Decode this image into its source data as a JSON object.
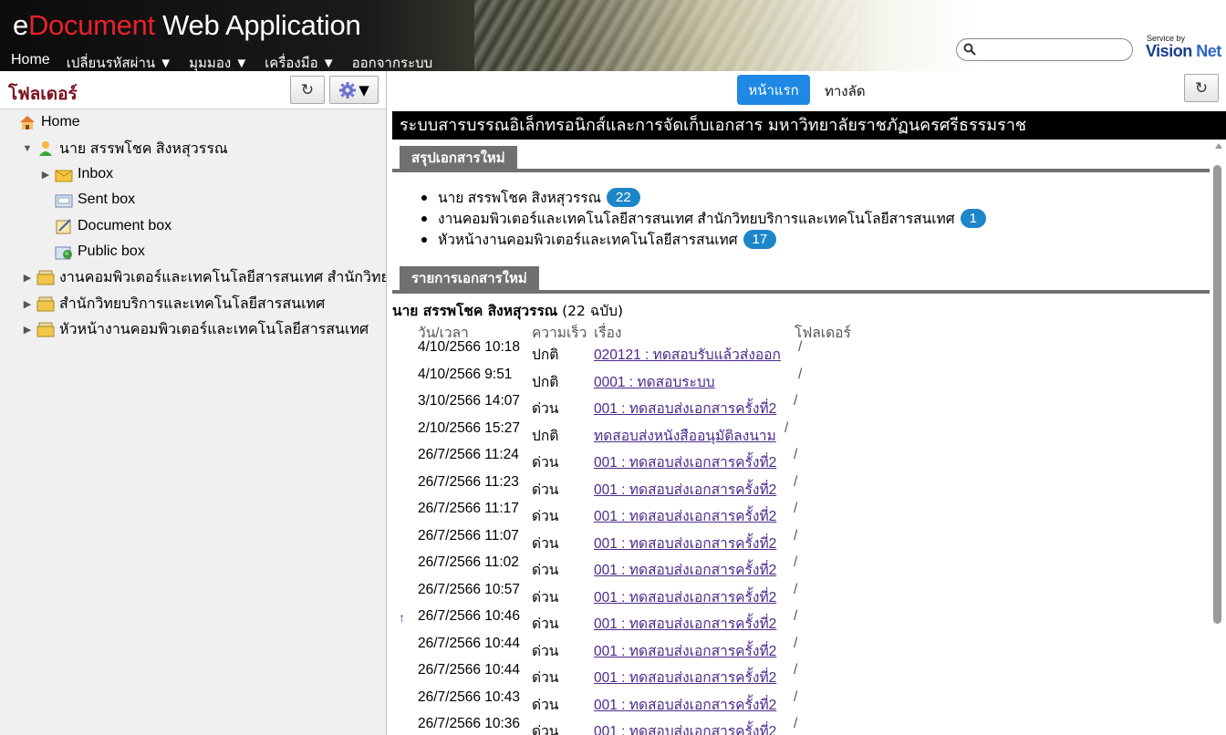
{
  "header": {
    "title_e": "e",
    "title_document": "Document",
    "title_rest": " Web Application",
    "nav": [
      {
        "label": "Home"
      },
      {
        "label": "เปลี่ยนรหัสผ่าน ▼"
      },
      {
        "label": "มุมมอง ▼"
      },
      {
        "label": "เครื่องมือ ▼"
      },
      {
        "label": "ออกจากระบบ"
      }
    ],
    "search": {
      "value": "",
      "placeholder": ""
    },
    "service_by": "Service by",
    "vision": "Vision",
    "net": "Net"
  },
  "left": {
    "title": "โฟลเดอร์",
    "refresh_icon": "refresh-icon",
    "settings_icon": "gear-icon",
    "tree": [
      {
        "label": "Home",
        "icon": "home-icon"
      },
      {
        "label": "นาย สรรพโชค สิงหสุวรรณ",
        "icon": "user-icon",
        "expanded": true
      },
      {
        "label": "Inbox",
        "icon": "inbox-icon"
      },
      {
        "label": "Sent box",
        "icon": "sent-box-icon"
      },
      {
        "label": "Document box",
        "icon": "document-box-icon"
      },
      {
        "label": "Public box",
        "icon": "public-box-icon"
      },
      {
        "label": "งานคอมพิวเตอร์และเทคโนโลยีสารสนเทศ สำนักวิทย",
        "icon": "folder-stack-icon"
      },
      {
        "label": "สำนักวิทยบริการและเทคโนโลยีสารสนเทศ",
        "icon": "folder-stack-icon"
      },
      {
        "label": "หัวหน้างานคอมพิวเตอร์และเทคโนโลยีสารสนเทศ",
        "icon": "folder-stack-icon"
      }
    ]
  },
  "right": {
    "tab_home": "หน้าแรก",
    "tab_shortcut": "ทางลัด",
    "banner": "ระบบสารบรรณอิเล็กทรอนิกส์และการจัดเก็บเอกสาร มหาวิทยาลัยราชภัฏนครศรีธรรมราช",
    "summary_title": "สรุปเอกสารใหม่",
    "summary": [
      {
        "label": "นาย สรรพโชค สิงหสุวรรณ",
        "count": "22"
      },
      {
        "label": "งานคอมพิวเตอร์และเทคโนโลยีสารสนเทศ สำนักวิทยบริการและเทคโนโลยีสารสนเทศ",
        "count": "1"
      },
      {
        "label": "หัวหน้างานคอมพิวเตอร์และเทคโนโลยีสารสนเทศ",
        "count": "17"
      }
    ],
    "list_title": "รายการเอกสารใหม่",
    "owner_name": "นาย สรรพโชค สิงหสุวรรณ",
    "owner_count": " (22 ฉบับ)",
    "columns": {
      "date": "วัน/เวลา",
      "speed": "ความเร็ว",
      "subject": "เรื่อง",
      "folder": "โฟลเดอร์"
    },
    "rows": [
      {
        "mark": "",
        "date": "4/10/2566 10:18",
        "speed": "ปกติ",
        "subject": "020121 : ทดสอบรับแล้วส่งออก",
        "folder": "/"
      },
      {
        "mark": "",
        "date": "4/10/2566 9:51",
        "speed": "ปกติ",
        "subject": "0001 : ทดสอบระบบ",
        "folder": "/"
      },
      {
        "mark": "",
        "date": "3/10/2566 14:07",
        "speed": "ด่วน",
        "subject": "001 : ทดสอบส่งเอกสารครั้งที่2",
        "folder": "/"
      },
      {
        "mark": "",
        "date": "2/10/2566 15:27",
        "speed": "ปกติ",
        "subject": "ทดสอบส่งหนังสืออนุมัติลงนาม",
        "folder": "/"
      },
      {
        "mark": "",
        "date": "26/7/2566 11:24",
        "speed": "ด่วน",
        "subject": "001 : ทดสอบส่งเอกสารครั้งที่2",
        "folder": "/"
      },
      {
        "mark": "",
        "date": "26/7/2566 11:23",
        "speed": "ด่วน",
        "subject": "001 : ทดสอบส่งเอกสารครั้งที่2",
        "folder": "/"
      },
      {
        "mark": "",
        "date": "26/7/2566 11:17",
        "speed": "ด่วน",
        "subject": "001 : ทดสอบส่งเอกสารครั้งที่2",
        "folder": "/"
      },
      {
        "mark": "",
        "date": "26/7/2566 11:07",
        "speed": "ด่วน",
        "subject": "001 : ทดสอบส่งเอกสารครั้งที่2",
        "folder": "/"
      },
      {
        "mark": "",
        "date": "26/7/2566 11:02",
        "speed": "ด่วน",
        "subject": "001 : ทดสอบส่งเอกสารครั้งที่2",
        "folder": "/"
      },
      {
        "mark": "",
        "date": "26/7/2566 10:57",
        "speed": "ด่วน",
        "subject": "001 : ทดสอบส่งเอกสารครั้งที่2",
        "folder": "/"
      },
      {
        "mark": "↑",
        "date": "26/7/2566 10:46",
        "speed": "ด่วน",
        "subject": "001 : ทดสอบส่งเอกสารครั้งที่2",
        "folder": "/"
      },
      {
        "mark": "",
        "date": "26/7/2566 10:44",
        "speed": "ด่วน",
        "subject": "001 : ทดสอบส่งเอกสารครั้งที่2",
        "folder": "/"
      },
      {
        "mark": "",
        "date": "26/7/2566 10:44",
        "speed": "ด่วน",
        "subject": "001 : ทดสอบส่งเอกสารครั้งที่2",
        "folder": "/"
      },
      {
        "mark": "",
        "date": "26/7/2566 10:43",
        "speed": "ด่วน",
        "subject": "001 : ทดสอบส่งเอกสารครั้งที่2",
        "folder": "/"
      },
      {
        "mark": "",
        "date": "26/7/2566 10:36",
        "speed": "ด่วน",
        "subject": "001 : ทดสอบส่งเอกสารครั้งที่2",
        "folder": "/"
      }
    ]
  },
  "colors": {
    "accent": "#1e88e5",
    "badge": "#1d86c9",
    "folder_title": "#7a1020",
    "banner": "#000000",
    "section": "#707070"
  }
}
